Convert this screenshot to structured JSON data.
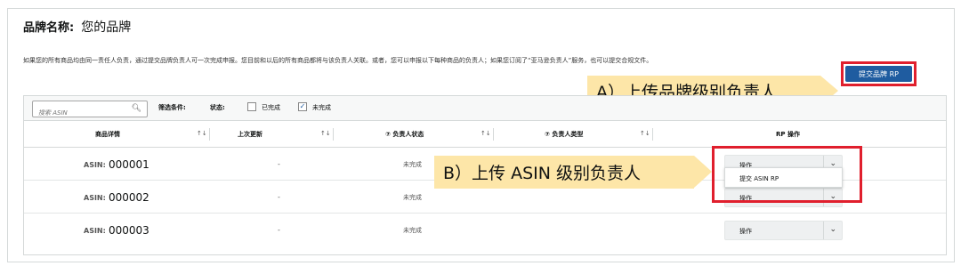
{
  "brand": {
    "label": "品牌名称:",
    "value": "您的品牌"
  },
  "description": "如果您的所有商品均由同一责任人负责，通过提交品牌负责人可一次完成申报。您目前和以后的所有商品都将与该负责人关联。或者，您可以申报以下每种商品的负责人；如果您订阅了“亚马逊负责人”服务，也可以提交合规文件。",
  "submit_brand_rp_label": "提交品牌 RP",
  "callouts": {
    "a": "A）上传品牌级别负责人",
    "b": "B）上传 ASIN 级别负责人"
  },
  "filter": {
    "search_placeholder": "搜索 ASIN",
    "filter_label": "筛选条件:",
    "status_label": "状态:",
    "completed_label": "已完成",
    "completed_checked": false,
    "incomplete_label": "未完成",
    "incomplete_checked": true
  },
  "columns": {
    "product_details": "商品详情",
    "last_updated": "上次更新",
    "rp_status": "⑦ 负责人状态",
    "rp_type": "⑦ 负责人类型",
    "rp_action": "RP 操作"
  },
  "rows": [
    {
      "asin_prefix": "ASIN:",
      "asin": "000001",
      "updated": "-",
      "status": "未完成",
      "action": "操作"
    },
    {
      "asin_prefix": "ASIN:",
      "asin": "000002",
      "updated": "-",
      "status": "未完成",
      "action": "操作"
    },
    {
      "asin_prefix": "ASIN:",
      "asin": "000003",
      "updated": "-",
      "status": "未完成",
      "action": "操作"
    }
  ],
  "dropdown": {
    "item": "提交 ASIN RP"
  },
  "icons": {
    "search": "search-icon",
    "sort": "sort-icon",
    "chevron": "chevron-down-icon",
    "check": "check-icon"
  },
  "colors": {
    "primary_button": "#1f5ca0",
    "highlight_box": "#e01f2d",
    "callout_bg": "#fde6a8"
  }
}
